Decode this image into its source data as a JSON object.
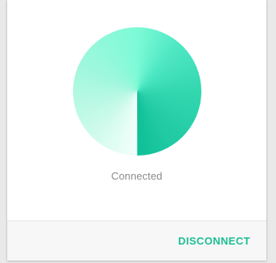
{
  "status": {
    "label": "Connected"
  },
  "footer": {
    "disconnect_label": "DISCONNECT"
  },
  "colors": {
    "accent": "#1dbd95",
    "orb_light": "#7dfad6",
    "orb_dark": "#0fbf96"
  }
}
